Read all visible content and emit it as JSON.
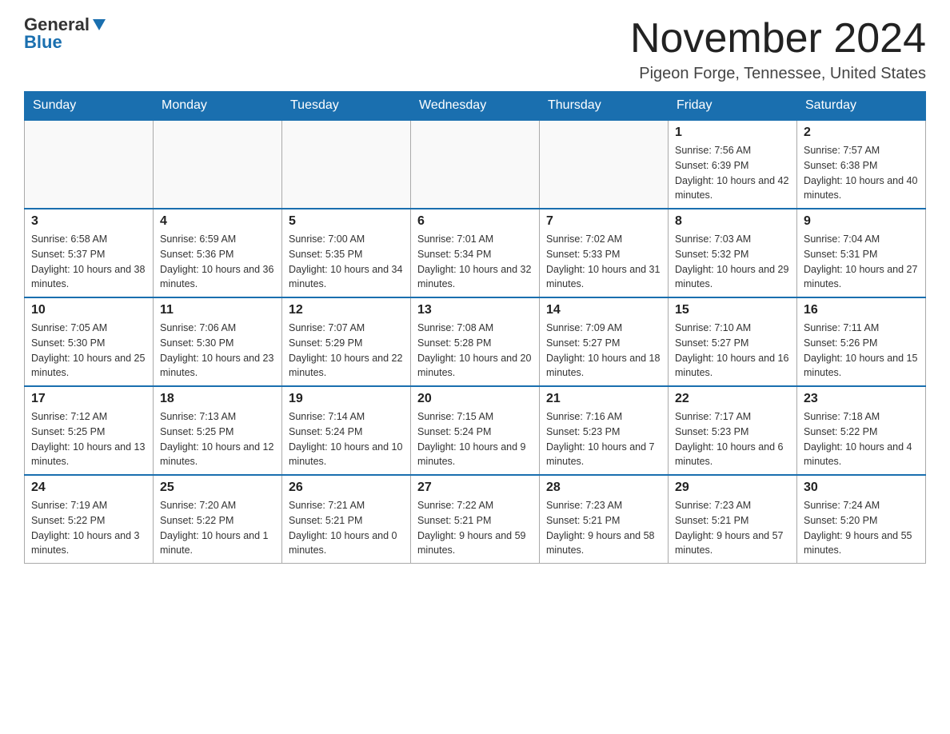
{
  "logo": {
    "general": "General",
    "blue": "Blue"
  },
  "title": {
    "month": "November 2024",
    "location": "Pigeon Forge, Tennessee, United States"
  },
  "weekdays": [
    "Sunday",
    "Monday",
    "Tuesday",
    "Wednesday",
    "Thursday",
    "Friday",
    "Saturday"
  ],
  "weeks": [
    [
      {
        "day": "",
        "info": ""
      },
      {
        "day": "",
        "info": ""
      },
      {
        "day": "",
        "info": ""
      },
      {
        "day": "",
        "info": ""
      },
      {
        "day": "",
        "info": ""
      },
      {
        "day": "1",
        "info": "Sunrise: 7:56 AM\nSunset: 6:39 PM\nDaylight: 10 hours and 42 minutes."
      },
      {
        "day": "2",
        "info": "Sunrise: 7:57 AM\nSunset: 6:38 PM\nDaylight: 10 hours and 40 minutes."
      }
    ],
    [
      {
        "day": "3",
        "info": "Sunrise: 6:58 AM\nSunset: 5:37 PM\nDaylight: 10 hours and 38 minutes."
      },
      {
        "day": "4",
        "info": "Sunrise: 6:59 AM\nSunset: 5:36 PM\nDaylight: 10 hours and 36 minutes."
      },
      {
        "day": "5",
        "info": "Sunrise: 7:00 AM\nSunset: 5:35 PM\nDaylight: 10 hours and 34 minutes."
      },
      {
        "day": "6",
        "info": "Sunrise: 7:01 AM\nSunset: 5:34 PM\nDaylight: 10 hours and 32 minutes."
      },
      {
        "day": "7",
        "info": "Sunrise: 7:02 AM\nSunset: 5:33 PM\nDaylight: 10 hours and 31 minutes."
      },
      {
        "day": "8",
        "info": "Sunrise: 7:03 AM\nSunset: 5:32 PM\nDaylight: 10 hours and 29 minutes."
      },
      {
        "day": "9",
        "info": "Sunrise: 7:04 AM\nSunset: 5:31 PM\nDaylight: 10 hours and 27 minutes."
      }
    ],
    [
      {
        "day": "10",
        "info": "Sunrise: 7:05 AM\nSunset: 5:30 PM\nDaylight: 10 hours and 25 minutes."
      },
      {
        "day": "11",
        "info": "Sunrise: 7:06 AM\nSunset: 5:30 PM\nDaylight: 10 hours and 23 minutes."
      },
      {
        "day": "12",
        "info": "Sunrise: 7:07 AM\nSunset: 5:29 PM\nDaylight: 10 hours and 22 minutes."
      },
      {
        "day": "13",
        "info": "Sunrise: 7:08 AM\nSunset: 5:28 PM\nDaylight: 10 hours and 20 minutes."
      },
      {
        "day": "14",
        "info": "Sunrise: 7:09 AM\nSunset: 5:27 PM\nDaylight: 10 hours and 18 minutes."
      },
      {
        "day": "15",
        "info": "Sunrise: 7:10 AM\nSunset: 5:27 PM\nDaylight: 10 hours and 16 minutes."
      },
      {
        "day": "16",
        "info": "Sunrise: 7:11 AM\nSunset: 5:26 PM\nDaylight: 10 hours and 15 minutes."
      }
    ],
    [
      {
        "day": "17",
        "info": "Sunrise: 7:12 AM\nSunset: 5:25 PM\nDaylight: 10 hours and 13 minutes."
      },
      {
        "day": "18",
        "info": "Sunrise: 7:13 AM\nSunset: 5:25 PM\nDaylight: 10 hours and 12 minutes."
      },
      {
        "day": "19",
        "info": "Sunrise: 7:14 AM\nSunset: 5:24 PM\nDaylight: 10 hours and 10 minutes."
      },
      {
        "day": "20",
        "info": "Sunrise: 7:15 AM\nSunset: 5:24 PM\nDaylight: 10 hours and 9 minutes."
      },
      {
        "day": "21",
        "info": "Sunrise: 7:16 AM\nSunset: 5:23 PM\nDaylight: 10 hours and 7 minutes."
      },
      {
        "day": "22",
        "info": "Sunrise: 7:17 AM\nSunset: 5:23 PM\nDaylight: 10 hours and 6 minutes."
      },
      {
        "day": "23",
        "info": "Sunrise: 7:18 AM\nSunset: 5:22 PM\nDaylight: 10 hours and 4 minutes."
      }
    ],
    [
      {
        "day": "24",
        "info": "Sunrise: 7:19 AM\nSunset: 5:22 PM\nDaylight: 10 hours and 3 minutes."
      },
      {
        "day": "25",
        "info": "Sunrise: 7:20 AM\nSunset: 5:22 PM\nDaylight: 10 hours and 1 minute."
      },
      {
        "day": "26",
        "info": "Sunrise: 7:21 AM\nSunset: 5:21 PM\nDaylight: 10 hours and 0 minutes."
      },
      {
        "day": "27",
        "info": "Sunrise: 7:22 AM\nSunset: 5:21 PM\nDaylight: 9 hours and 59 minutes."
      },
      {
        "day": "28",
        "info": "Sunrise: 7:23 AM\nSunset: 5:21 PM\nDaylight: 9 hours and 58 minutes."
      },
      {
        "day": "29",
        "info": "Sunrise: 7:23 AM\nSunset: 5:21 PM\nDaylight: 9 hours and 57 minutes."
      },
      {
        "day": "30",
        "info": "Sunrise: 7:24 AM\nSunset: 5:20 PM\nDaylight: 9 hours and 55 minutes."
      }
    ]
  ]
}
